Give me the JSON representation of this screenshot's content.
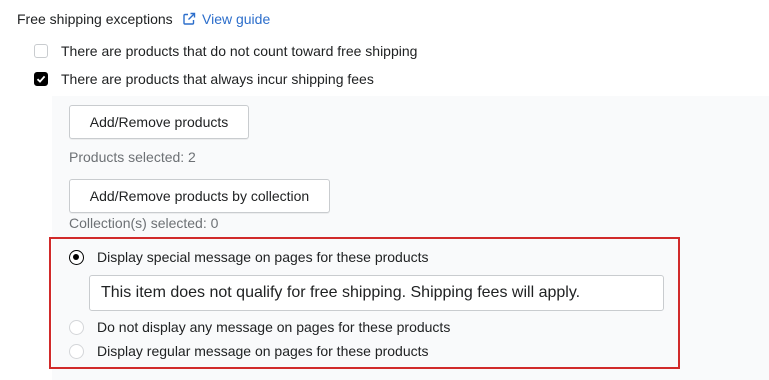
{
  "section": {
    "title": "Free shipping exceptions",
    "guide_link": "View guide",
    "guide_icon": "external-link-icon",
    "link_color": "#2c6ecb"
  },
  "options": {
    "excluded_products": {
      "label": "There are products that do not count toward free shipping",
      "checked": false
    },
    "always_fee_products": {
      "label": "There are products that always incur shipping fees",
      "checked": true
    }
  },
  "panel": {
    "add_products_button": "Add/Remove products",
    "products_selected": "Products selected: 2",
    "add_collection_button": "Add/Remove products by collection",
    "collections_selected": "Collection(s) selected: 0"
  },
  "message_options": {
    "special": {
      "label": "Display special message on pages for these products",
      "selected": true
    },
    "special_message_value": "This item does not qualify for free shipping. Shipping fees will apply.",
    "none": {
      "label": "Do not display any message on pages for these products",
      "selected": false
    },
    "regular": {
      "label": "Display regular message on pages for these products",
      "selected": false
    }
  },
  "colors": {
    "highlight_border": "#d12a2a",
    "panel_background": "#f9fafb"
  }
}
